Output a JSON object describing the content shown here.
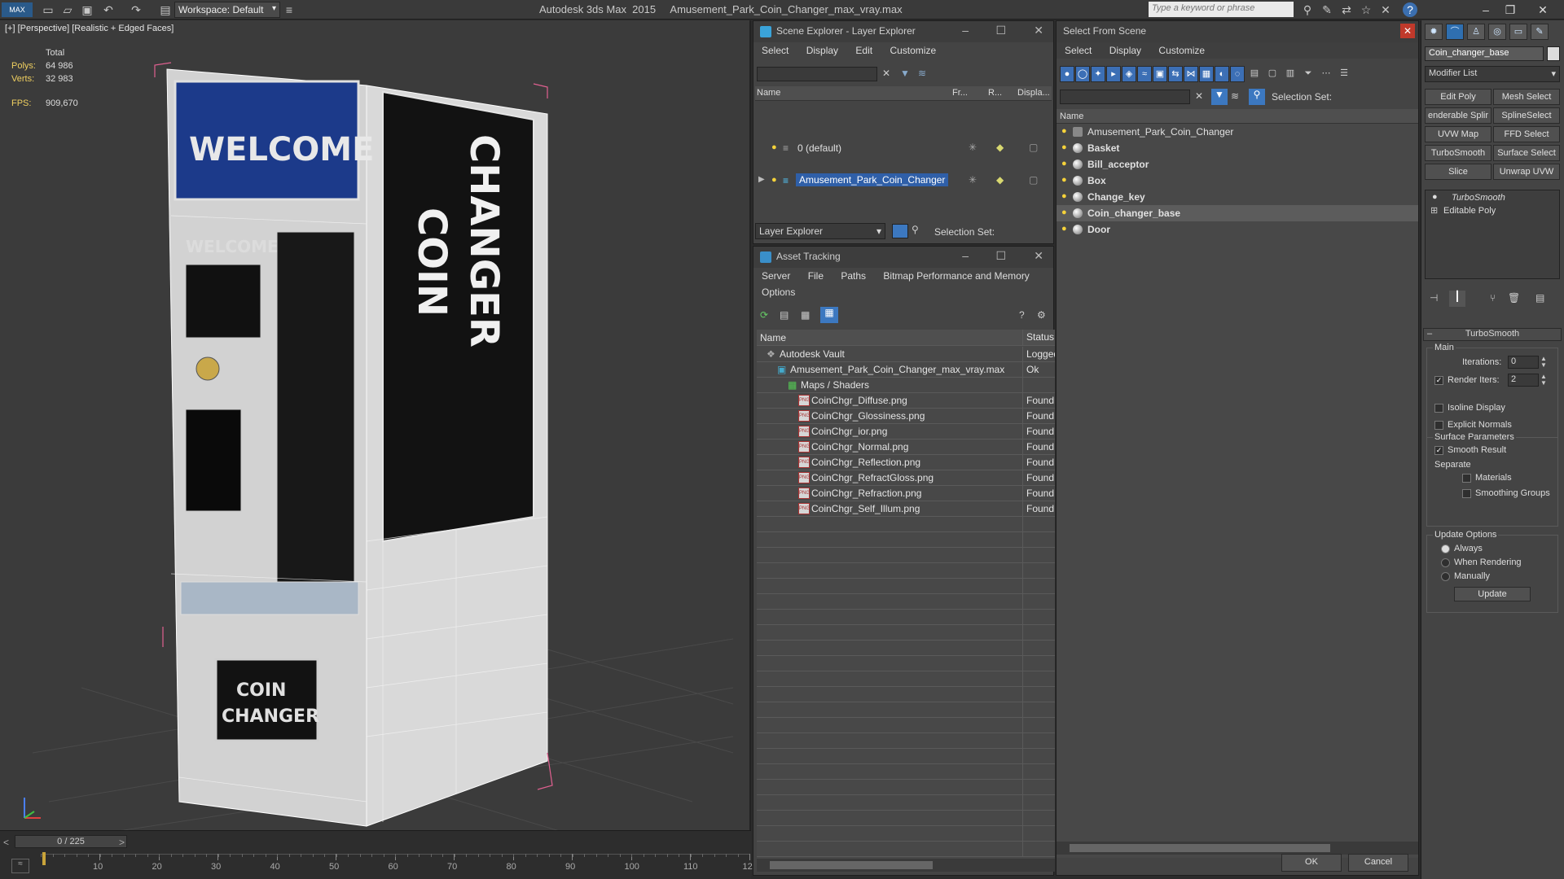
{
  "titlebar": {
    "workspace": "Workspace: Default",
    "title": "Autodesk 3ds Max  2015     Amusement_Park_Coin_Changer_max_vray.max",
    "search_placeholder": "Type a keyword or phrase"
  },
  "viewport": {
    "label": "[+] [Perspective] [Realistic + Edged Faces]",
    "stats_total": "Total",
    "polys_label": "Polys:",
    "polys_value": "64 986",
    "verts_label": "Verts:",
    "verts_value": "32 983",
    "fps_label": "FPS:",
    "fps_value": "909,670",
    "sign_welcome": "WELCOME",
    "sign_coin": "COIN",
    "sign_changer": "CHANGER",
    "small_welcome": "WELCOME",
    "panel_coin": "COIN",
    "panel_changer": "CHANGER"
  },
  "timeline": {
    "frame": "0 / 225",
    "ticks": [
      "10",
      "20",
      "30",
      "40",
      "50",
      "60",
      "70",
      "80",
      "90",
      "100",
      "110",
      "12"
    ]
  },
  "scene_explorer": {
    "title": "Scene Explorer - Layer Explorer",
    "menu": [
      "Select",
      "Display",
      "Edit",
      "Customize"
    ],
    "col_name": "Name",
    "col_fr": "Fr...",
    "col_r": "R...",
    "col_disp": "Displa...",
    "layers": [
      "0 (default)",
      "Amusement_Park_Coin_Changer"
    ],
    "footer_dropdown": "Layer Explorer",
    "footer_selection": "Selection Set:"
  },
  "asset_tracking": {
    "title": "Asset Tracking",
    "menu1": [
      "Server",
      "File",
      "Paths",
      "Bitmap Performance and Memory"
    ],
    "menu2": [
      "Options"
    ],
    "col_name": "Name",
    "col_status": "Status",
    "rows": [
      {
        "name": "Autodesk Vault",
        "status": "Logged",
        "indent": 1
      },
      {
        "name": "Amusement_Park_Coin_Changer_max_vray.max",
        "status": "Ok",
        "indent": 2
      },
      {
        "name": "Maps / Shaders",
        "status": "",
        "indent": 3
      },
      {
        "name": "CoinChgr_Diffuse.png",
        "status": "Found",
        "indent": 4
      },
      {
        "name": "CoinChgr_Glossiness.png",
        "status": "Found",
        "indent": 4
      },
      {
        "name": "CoinChgr_ior.png",
        "status": "Found",
        "indent": 4
      },
      {
        "name": "CoinChgr_Normal.png",
        "status": "Found",
        "indent": 4
      },
      {
        "name": "CoinChgr_Reflection.png",
        "status": "Found",
        "indent": 4
      },
      {
        "name": "CoinChgr_RefractGloss.png",
        "status": "Found",
        "indent": 4
      },
      {
        "name": "CoinChgr_Refraction.png",
        "status": "Found",
        "indent": 4
      },
      {
        "name": "CoinChgr_Self_Illum.png",
        "status": "Found",
        "indent": 4
      }
    ]
  },
  "select_from_scene": {
    "title": "Select From Scene",
    "menu": [
      "Select",
      "Display",
      "Customize"
    ],
    "selection_set": "Selection Set:",
    "col_name": "Name",
    "items": [
      "Amusement_Park_Coin_Changer",
      "Basket",
      "Bill_acceptor",
      "Box",
      "Change_key",
      "Coin_changer_base",
      "Door"
    ],
    "ok": "OK",
    "cancel": "Cancel"
  },
  "command_panel": {
    "object_name": "Coin_changer_base",
    "modifier_list": "Modifier List",
    "buttons": [
      "Edit Poly",
      "Mesh Select",
      "enderable Splir",
      "SplineSelect",
      "UVW Map",
      "FFD Select",
      "TurboSmooth",
      "Surface Select",
      "Slice",
      "Unwrap UVW"
    ],
    "stack": [
      "TurboSmooth",
      "Editable Poly"
    ],
    "rollout_title": "TurboSmooth",
    "main": "Main",
    "iterations_label": "Iterations:",
    "iterations_value": "0",
    "render_iters_label": "Render Iters:",
    "render_iters_value": "2",
    "isoline": "Isoline Display",
    "explicit": "Explicit Normals",
    "surface_params": "Surface Parameters",
    "smooth_result": "Smooth Result",
    "separate": "Separate",
    "materials": "Materials",
    "smoothing_groups": "Smoothing Groups",
    "update_options": "Update Options",
    "always": "Always",
    "when_rendering": "When Rendering",
    "manually": "Manually",
    "update": "Update"
  }
}
